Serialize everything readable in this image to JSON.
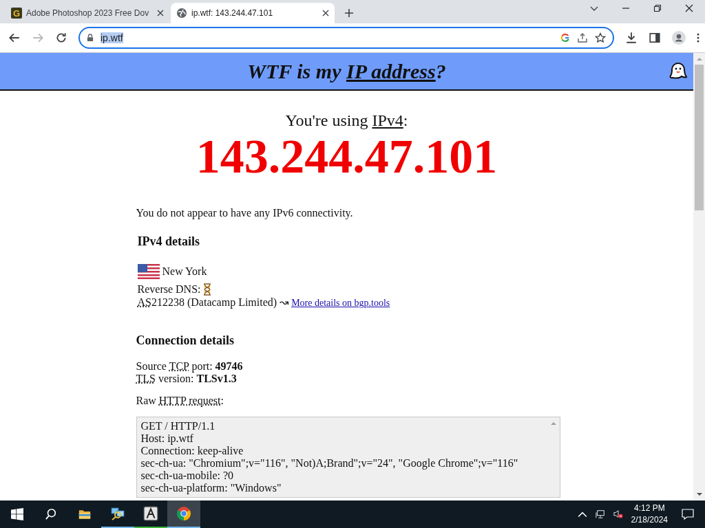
{
  "browser": {
    "tabs": [
      {
        "title": "Adobe Photoshop 2023 Free Dov",
        "favicon_letter": "G",
        "selected": false
      },
      {
        "title": "ip.wtf: 143.244.47.101",
        "selected": true
      }
    ],
    "address": "ip.wtf"
  },
  "page": {
    "header": {
      "before": "WTF is my ",
      "link": "IP address",
      "after": "?"
    },
    "using": {
      "before": "You're using ",
      "link": "IPv4",
      "after": ":"
    },
    "ip": "143.244.47.101",
    "ipv6_note": "You do not appear to have any IPv6 connectivity.",
    "ipv4_heading": "IPv4 details",
    "city": "New York",
    "reverse_dns": "Reverse DNS:",
    "asn": {
      "abbr": "AS",
      "rest": "212238 (Datacamp Limited) ↝",
      "link": "More details on bgp.tools"
    },
    "connection_heading": "Connection details",
    "details": [
      {
        "before": "Source ",
        "abbr": "TCP",
        "after": " port: ",
        "value": "49746"
      },
      {
        "abbr": "TLS",
        "after": " version: ",
        "value": "TLSv1.3"
      }
    ],
    "raw": {
      "before": "Raw ",
      "abbr": "HTTP request",
      "after": ":"
    },
    "request_lines": [
      "GET / HTTP/1.1",
      "Host: ip.wtf",
      "Connection: keep-alive",
      "sec-ch-ua: \"Chromium\";v=\"116\", \"Not)A;Brand\";v=\"24\", \"Google Chrome\";v=\"116\"",
      "sec-ch-ua-mobile: ?0",
      "sec-ch-ua-platform: \"Windows\""
    ]
  },
  "taskbar": {
    "time": "4:12 PM",
    "date": "2/18/2024"
  }
}
